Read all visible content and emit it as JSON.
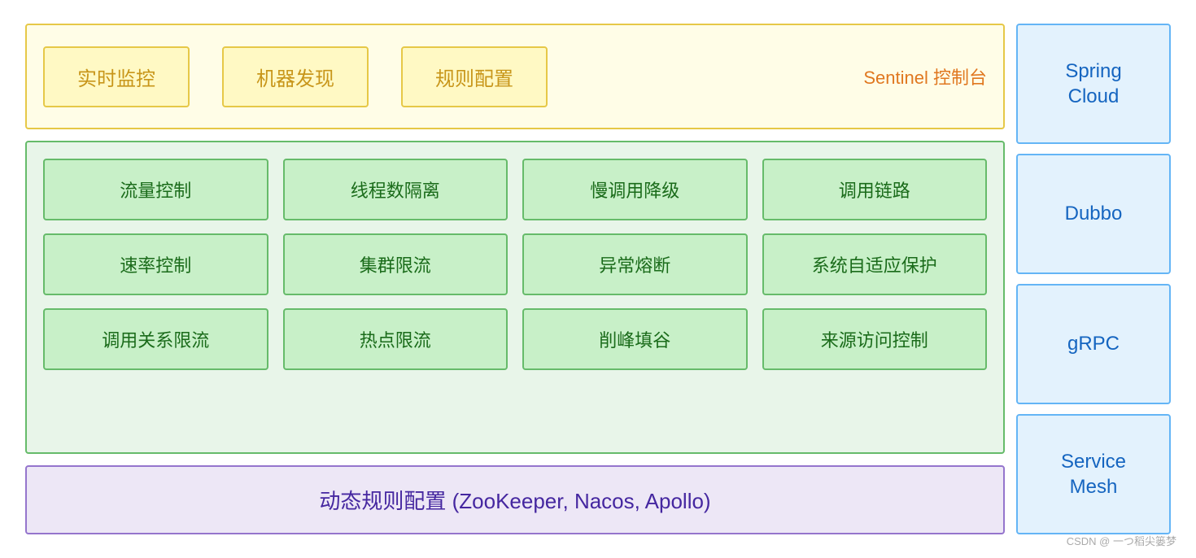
{
  "sentinel": {
    "box1": "实时监控",
    "box2": "机器发现",
    "box3": "规则配置",
    "label": "Sentinel 控制台"
  },
  "features": {
    "row1": [
      "流量控制",
      "线程数隔离",
      "慢调用降级",
      "调用链路"
    ],
    "row2": [
      "速率控制",
      "集群限流",
      "异常熔断",
      "系统自适应保护"
    ],
    "row3": [
      "调用关系限流",
      "热点限流",
      "削峰填谷",
      "来源访问控制"
    ]
  },
  "dynamic": {
    "text": "动态规则配置 (ZooKeeper, Nacos, Apollo)"
  },
  "sidebar": {
    "items": [
      "Spring\nCloud",
      "Dubbo",
      "gRPC",
      "Service\nMesh"
    ]
  },
  "watermark": "CSDN @ 一つ稻尖篓梦"
}
